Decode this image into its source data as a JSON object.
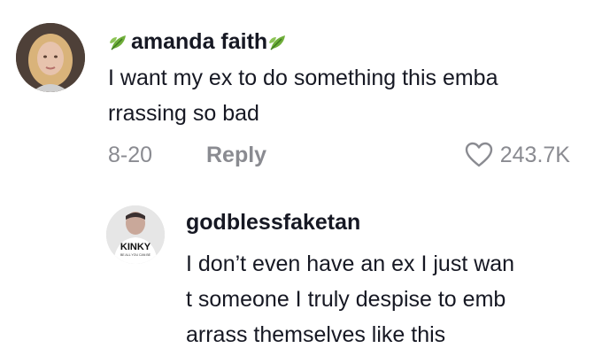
{
  "comment": {
    "username": "amanda faith",
    "text_lines": [
      "I want my ex to do something this emba",
      "rrassing so bad"
    ],
    "date": "8-20",
    "reply_label": "Reply",
    "like_count": "243.7K"
  },
  "reply": {
    "username": "godblessfaketan",
    "avatar_shirt_text": "KINKY",
    "avatar_shirt_subtext": "BE ALL YOU CAN BE",
    "text_lines": [
      "I don’t even have an ex I just wan",
      "t someone I truly despise to emb",
      "arrass themselves like this"
    ]
  }
}
